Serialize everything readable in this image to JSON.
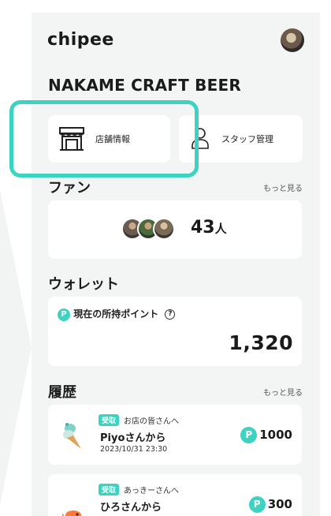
{
  "app": {
    "logo": "chipee"
  },
  "shop": {
    "name": "NAKAME CRAFT BEER"
  },
  "menu": {
    "shop_info": "店舗情報",
    "staff_management": "スタッフ管理"
  },
  "fans": {
    "title": "ファン",
    "more": "もっと見る",
    "count": "43",
    "unit": "人"
  },
  "wallet": {
    "title": "ウォレット",
    "label": "現在の所持ポイント",
    "points": "1,320",
    "badge": "P",
    "help": "?"
  },
  "history": {
    "title": "履歴",
    "more": "もっと見る",
    "items": [
      {
        "tag": "受取",
        "to": "お店の皆さんへ",
        "from": "Piyoさんから",
        "date": "2023/10/31 23:30",
        "points": "1000",
        "icon": "ice-cream-icon"
      },
      {
        "tag": "受取",
        "to": "あっきーさんへ",
        "from": "ひろさんから",
        "date": "",
        "points": "300",
        "icon": "fish-icon"
      }
    ]
  },
  "colors": {
    "accent": "#3cd3c2",
    "panel_bg": "#f3f5f5",
    "card_bg": "#ffffff"
  }
}
